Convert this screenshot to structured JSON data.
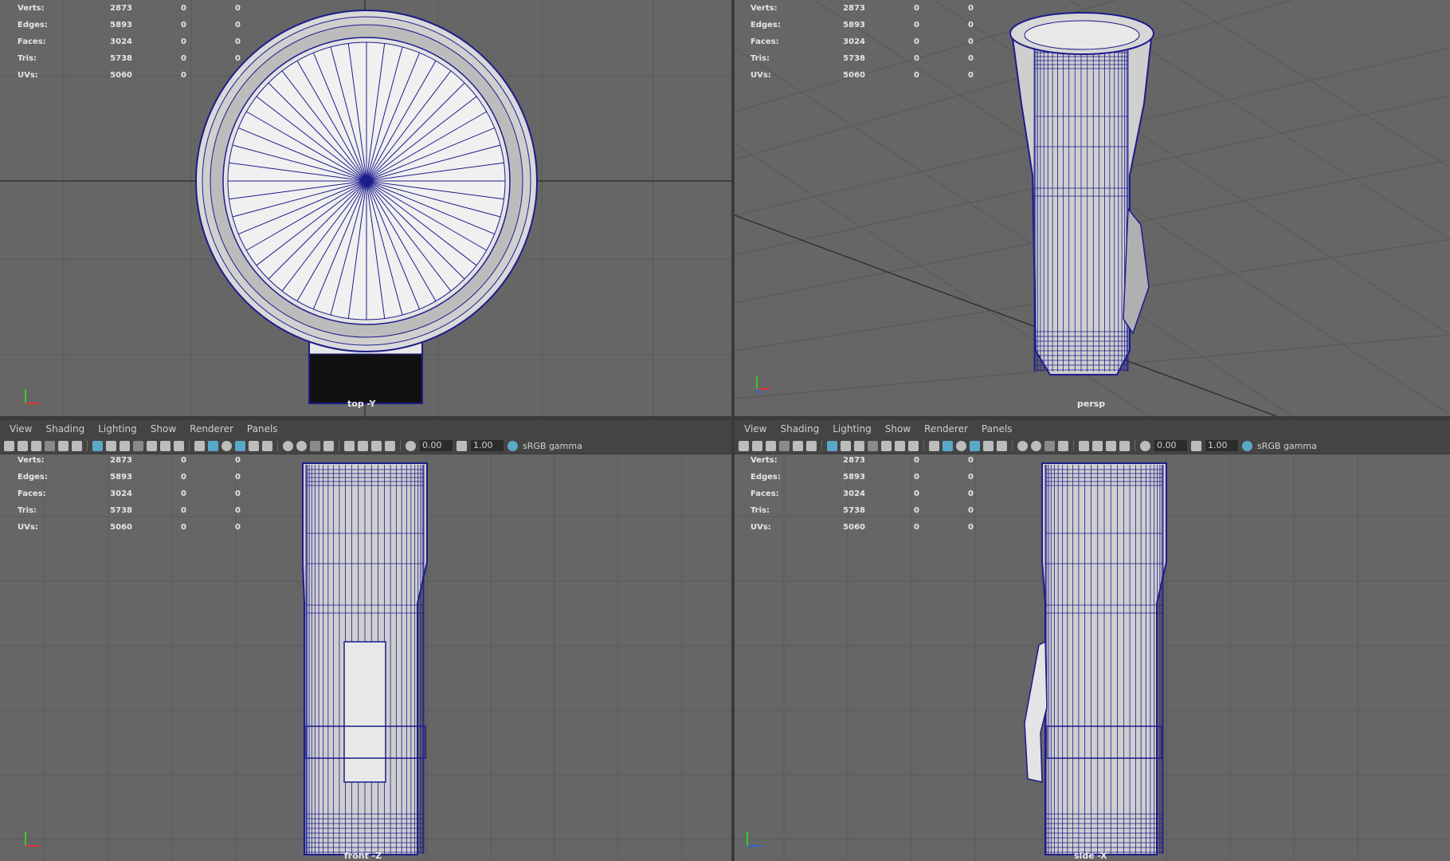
{
  "menu": [
    "View",
    "Shading",
    "Lighting",
    "Show",
    "Renderer",
    "Panels"
  ],
  "toolbar": {
    "exposure": "0.00",
    "gamma_value": "1.00",
    "color_space": "sRGB gamma"
  },
  "hud_labels": [
    "Verts:",
    "Edges:",
    "Faces:",
    "Tris:",
    "UVs:"
  ],
  "hud_values": [
    [
      "2873",
      "0",
      "0"
    ],
    [
      "5893",
      "0",
      "0"
    ],
    [
      "3024",
      "0",
      "0"
    ],
    [
      "5738",
      "0",
      "0"
    ],
    [
      "5060",
      "0",
      "0"
    ]
  ],
  "viewports": {
    "top": {
      "camera": "top -Y"
    },
    "persp": {
      "camera": "persp"
    },
    "front": {
      "camera": "front -Z"
    },
    "side": {
      "camera": "side -X"
    }
  },
  "colors": {
    "viewport_bg": "#666666",
    "grid": "#5a5a5a",
    "grid_axis": "#333333",
    "wireframe": "#1c1c8c",
    "mesh_light": "#f0f0f0",
    "toolbar_bg": "#444444",
    "accent": "#5aa8c8"
  }
}
